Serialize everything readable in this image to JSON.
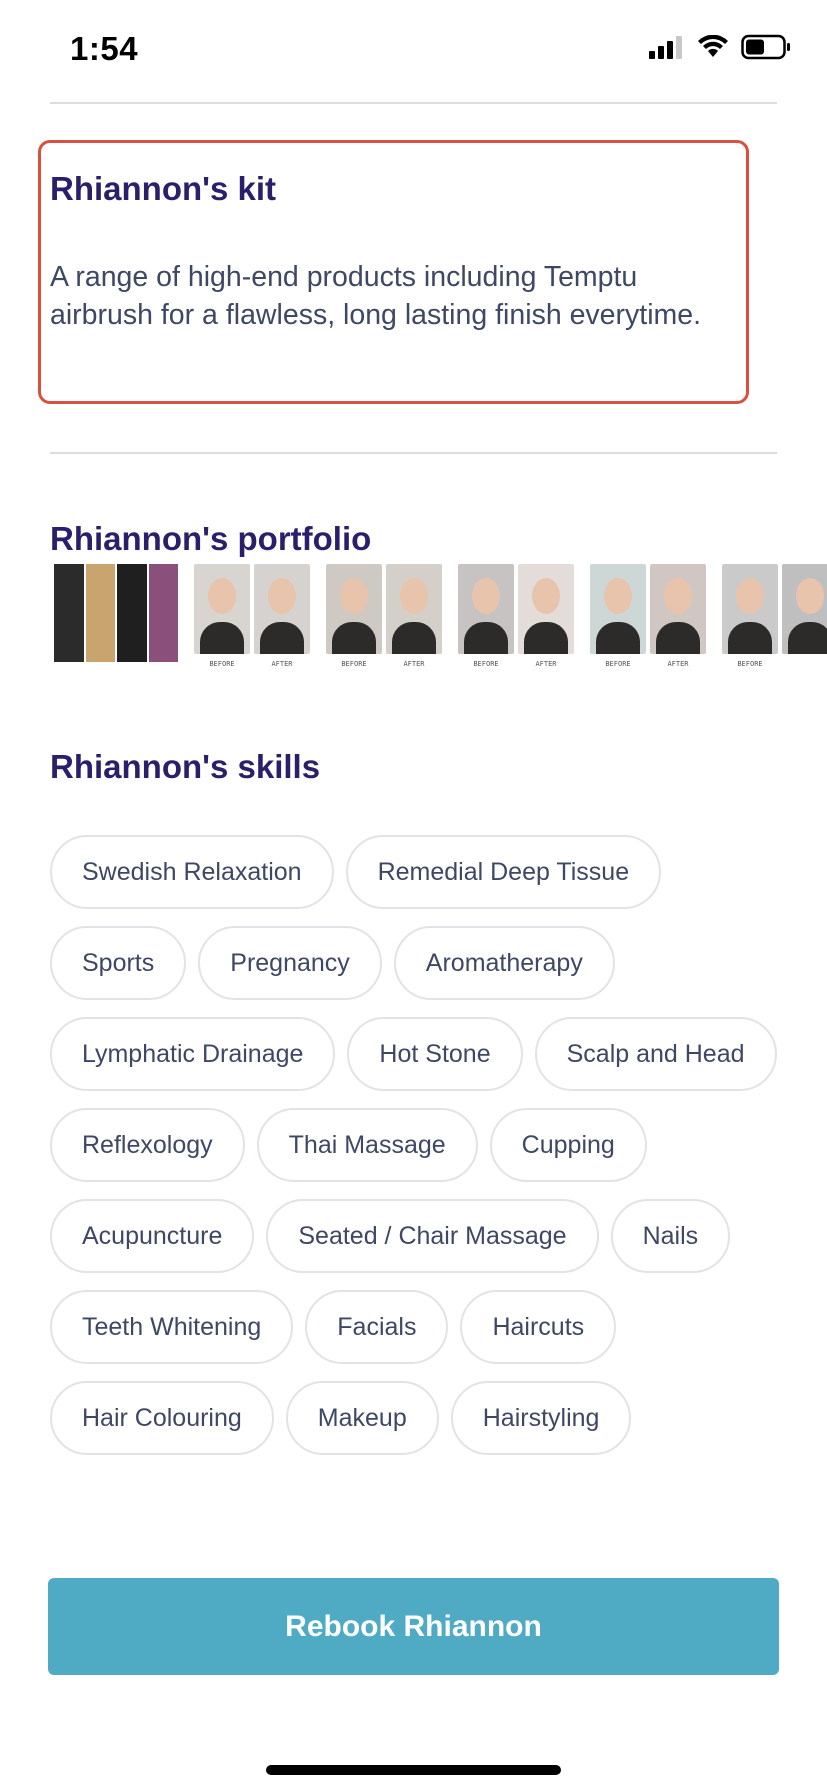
{
  "status_bar": {
    "time": "1:54"
  },
  "kit": {
    "title": "Rhiannon's kit",
    "description": "A range of high-end products including Temptu airbrush for a flawless,  long lasting finish everytime."
  },
  "portfolio": {
    "title": "Rhiannon's portfolio",
    "captions": [
      "BEFORE",
      "AFTER",
      "BEFORE",
      "AFTER",
      "BEFORE",
      "AFTER",
      "BEFORE",
      "AFTER",
      "BEFORE"
    ]
  },
  "skills": {
    "title": "Rhiannon's skills",
    "items": [
      "Swedish Relaxation",
      "Remedial Deep Tissue",
      "Sports",
      "Pregnancy",
      "Aromatherapy",
      "Lymphatic Drainage",
      "Hot Stone",
      "Scalp and Head",
      "Reflexology",
      "Thai Massage",
      "Cupping",
      "Acupuncture",
      "Seated / Chair Massage",
      "Nails",
      "Teeth Whitening",
      "Facials",
      "Haircuts",
      "Hair Colouring",
      "Makeup",
      "Hairstyling"
    ]
  },
  "rebook_button": {
    "label": "Rebook Rhiannon",
    "color": "#4faac4"
  },
  "colors": {
    "heading": "#2b1e6b",
    "highlight_border": "#d9503f",
    "body_text": "#3f4863"
  }
}
